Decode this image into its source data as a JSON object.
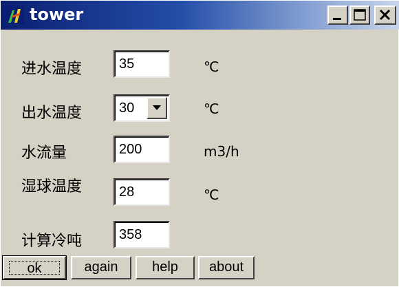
{
  "window": {
    "title": "tower"
  },
  "titlebar_buttons": {
    "minimize": "minimize",
    "maximize": "maximize",
    "close": "close"
  },
  "form": {
    "inlet_temp": {
      "label": "进水温度",
      "value": "35",
      "unit": "℃"
    },
    "outlet_temp": {
      "label": "出水温度",
      "value": "30",
      "unit": "℃"
    },
    "flow": {
      "label": "水流量",
      "value": "200",
      "unit": "m3/h"
    },
    "wetbulb_temp": {
      "label": "湿球温度",
      "value": "28",
      "unit": "℃"
    },
    "cooling": {
      "label": "计算冷吨",
      "value": "358"
    }
  },
  "buttons": {
    "ok": "ok",
    "again": "again",
    "help": "help",
    "about": "about"
  },
  "colors": {
    "titlebar_start": "#0a1f72",
    "titlebar_end": "#c9d5ea",
    "window_bg": "#d6d1c5"
  }
}
